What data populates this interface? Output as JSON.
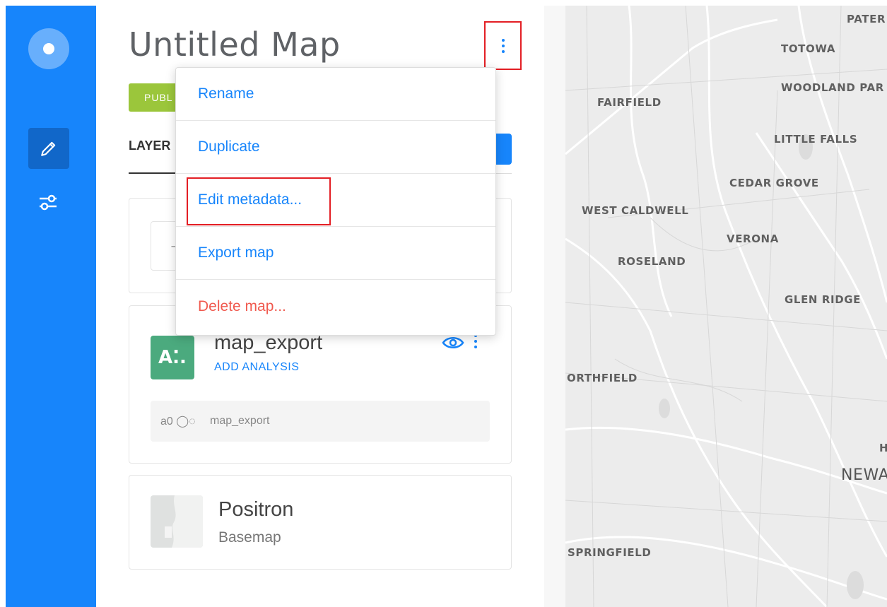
{
  "nav": {
    "logo_icon": "carto-logo-icon",
    "edit_icon": "pencil-icon",
    "settings_icon": "sliders-icon",
    "color": "#1785FB"
  },
  "header": {
    "title": "Untitled Map",
    "privacy_label": "PUBLIC",
    "privacy_visible": "PUBL",
    "options_icon": "kebab-menu-icon"
  },
  "tabs": {
    "layers_label": "LAYER"
  },
  "menu": {
    "items": [
      {
        "label": "Rename"
      },
      {
        "label": "Duplicate"
      },
      {
        "label": "Edit metadata..."
      },
      {
        "label": "Export map"
      },
      {
        "label": "Delete map..."
      }
    ]
  },
  "layers": {
    "layer": {
      "thumb_text": "A⁚.",
      "name": "map_export",
      "add_analysis": "ADD ANALYSIS",
      "analysis_id": "a0 ◯◌",
      "analysis_source": "map_export"
    },
    "basemap": {
      "name": "Positron",
      "type": "Basemap"
    }
  },
  "map": {
    "labels": [
      "PATER",
      "TOTOWA",
      "WOODLAND PAR",
      "FAIRFIELD",
      "LITTLE FALLS",
      "CEDAR GROVE",
      "WEST CALDWELL",
      "VERONA",
      "ROSELAND",
      "GLEN RIDGE",
      "ORTHFIELD",
      "H",
      "NEWA",
      "SPRINGFIELD"
    ]
  },
  "colors": {
    "accent": "#1785FB",
    "danger": "#F05A4F",
    "public_badge": "#9BC63B",
    "layer_thumb": "#4BAA7E",
    "highlight": "#e31e24"
  }
}
